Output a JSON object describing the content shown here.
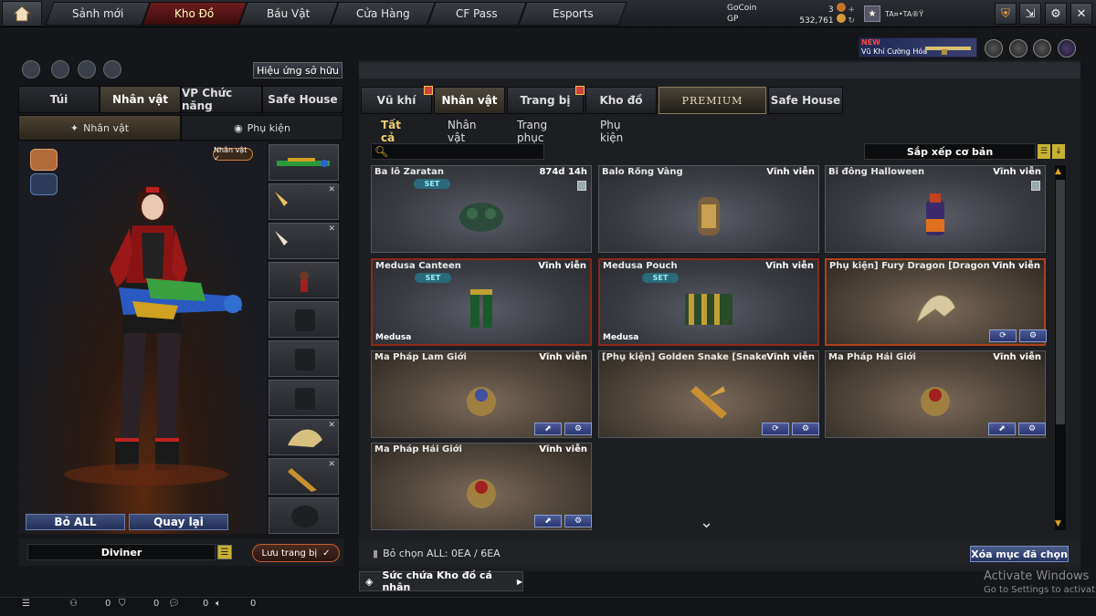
{
  "topbar": {
    "tabs": [
      "Sảnh mới",
      "Kho Đồ",
      "Báu Vật",
      "Cửa Hàng",
      "CF Pass",
      "Esports"
    ],
    "active_tab": "Kho Đồ",
    "gocoin_label": "GoCoin",
    "gocoin_value": "3",
    "gp_label": "GP",
    "gp_value": "532,761",
    "player_name": "TA¤•TA®Ÿ",
    "icons": [
      "home-icon",
      "shield-icon",
      "exit-icon",
      "gear-icon",
      "close-icon"
    ]
  },
  "promo": {
    "new_label": "NEW",
    "text": "Vũ Khí Cường Hóa"
  },
  "left": {
    "effect_button": "Hiệu ứng sở hữu",
    "tabs": [
      "Túi",
      "Nhân vật",
      "VP Chức năng",
      "Safe House"
    ],
    "active_tab": "Nhân vật",
    "subtabs": [
      "Nhân vật",
      "Phụ kiện"
    ],
    "char_badge": "Nhân vật ✓",
    "btn_bo_all": "Bỏ ALL",
    "btn_back": "Quay lại",
    "character_name": "Diviner",
    "btn_save": "Lưu trang bị"
  },
  "right": {
    "tabs": [
      "Vũ khí",
      "Nhân vật",
      "Trang bị",
      "Kho đồ",
      "PREMIUM",
      "Safe House"
    ],
    "active_tab": "Nhân vật",
    "filters": [
      "Tất cả",
      "Nhân vật",
      "Trang phục",
      "Phụ kiện"
    ],
    "active_filter": "Tất cả",
    "sort_label": "Sắp xếp cơ bản",
    "search_placeholder": "",
    "items": [
      {
        "name": "Ba lô Zaratan",
        "duration": "874d 14h",
        "set": "SET",
        "tag": ""
      },
      {
        "name": "Balo Rồng Vàng",
        "duration": "Vĩnh viễn",
        "set": "",
        "tag": ""
      },
      {
        "name": "Bi đông Halloween",
        "duration": "Vĩnh viễn",
        "set": "",
        "tag": ""
      },
      {
        "name": "Medusa Canteen",
        "duration": "Vĩnh viễn",
        "set": "SET",
        "tag": "Medusa"
      },
      {
        "name": "Medusa Pouch",
        "duration": "Vĩnh viễn",
        "set": "SET",
        "tag": "Medusa"
      },
      {
        "name": "Phụ kiện] Fury Dragon [Dragon Fury",
        "duration": "Vĩnh viễn",
        "set": "",
        "tag": ""
      },
      {
        "name": "Ma Pháp Lam Giới",
        "duration": "Vĩnh viễn",
        "set": "",
        "tag": ""
      },
      {
        "name": "[Phụ kiện] Golden Snake [Snake]",
        "duration": "Vĩnh viễn",
        "set": "",
        "tag": ""
      },
      {
        "name": "Ma Pháp Hải Giới",
        "duration": "Vĩnh viễn",
        "set": "",
        "tag": ""
      },
      {
        "name": "Ma Pháp Hải Giới",
        "duration": "Vĩnh viễn",
        "set": "",
        "tag": ""
      }
    ],
    "select_all": "Bỏ chọn ALL: 0EA / 6EA",
    "btn_delete": "Xóa mục đã chọn",
    "storage": "Sức chứa Kho đồ cá nhân"
  },
  "watermark": {
    "line1": "Activate Windows",
    "line2": "Go to Settings to activat"
  },
  "bottombar": {
    "counts": [
      "0",
      "0",
      "0",
      "0"
    ]
  }
}
